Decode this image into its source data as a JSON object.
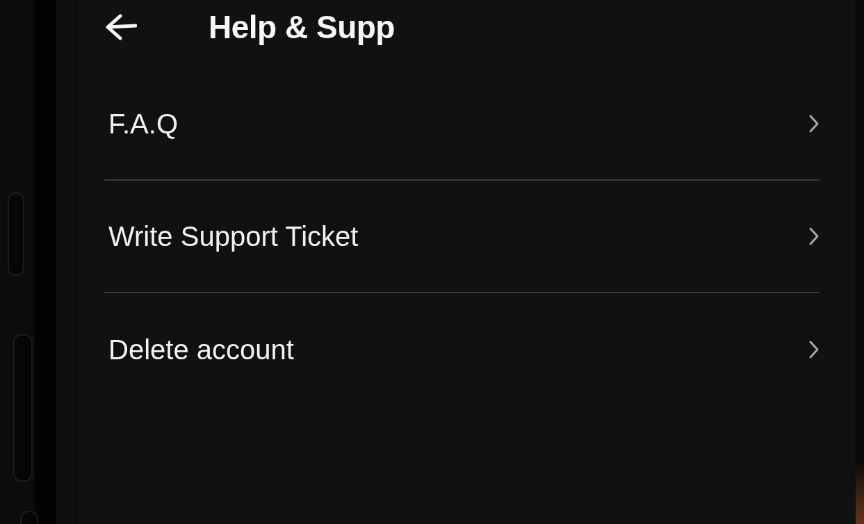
{
  "header": {
    "title": "Help & Supp"
  },
  "items": [
    {
      "label": "F.A.Q"
    },
    {
      "label": "Write Support Ticket"
    },
    {
      "label": "Delete account"
    }
  ]
}
